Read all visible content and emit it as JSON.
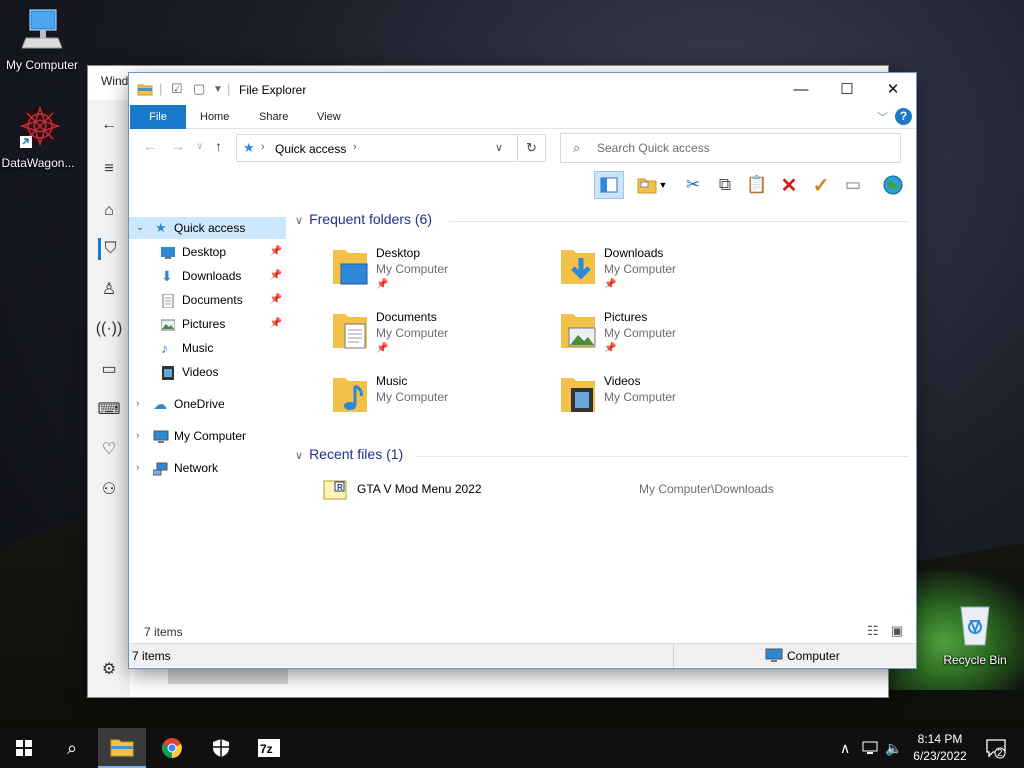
{
  "desktop": {
    "icons": [
      {
        "label": "My Computer"
      },
      {
        "label": "DataWagon..."
      },
      {
        "label": "Recycle Bin"
      }
    ]
  },
  "settings_window": {
    "title": "Wind"
  },
  "explorer": {
    "title": "File Explorer",
    "ribbon_tabs": [
      "File",
      "Home",
      "Share",
      "View"
    ],
    "address": "Quick access",
    "search_placeholder": "Search Quick access",
    "nav": [
      {
        "label": "Quick access",
        "icon": "star-icon",
        "selected": true
      },
      {
        "label": "Desktop",
        "icon": "desktop-icon",
        "pinned": true
      },
      {
        "label": "Downloads",
        "icon": "download-icon",
        "pinned": true
      },
      {
        "label": "Documents",
        "icon": "document-icon",
        "pinned": true
      },
      {
        "label": "Pictures",
        "icon": "picture-icon",
        "pinned": true
      },
      {
        "label": "Music",
        "icon": "music-icon"
      },
      {
        "label": "Videos",
        "icon": "video-icon"
      },
      {
        "label": "OneDrive",
        "icon": "cloud-icon"
      },
      {
        "label": "My Computer",
        "icon": "computer-icon"
      },
      {
        "label": "Network",
        "icon": "network-icon"
      }
    ],
    "frequent_header": "Frequent folders (6)",
    "folders": [
      {
        "name": "Desktop",
        "location": "My Computer",
        "pinned": true
      },
      {
        "name": "Downloads",
        "location": "My Computer",
        "pinned": true
      },
      {
        "name": "Documents",
        "location": "My Computer",
        "pinned": true
      },
      {
        "name": "Pictures",
        "location": "My Computer",
        "pinned": true
      },
      {
        "name": "Music",
        "location": "My Computer",
        "pinned": false
      },
      {
        "name": "Videos",
        "location": "My Computer",
        "pinned": false
      }
    ],
    "recent_header": "Recent files (1)",
    "recent_files": [
      {
        "name": "GTA V Mod Menu 2022",
        "path": "My Computer\\Downloads"
      }
    ],
    "status_items": "7 items",
    "status_items2": "7 items",
    "status_location": "Computer"
  },
  "taskbar": {
    "time": "8:14 PM",
    "date": "6/23/2022",
    "notification_count": "2",
    "pinned": [
      "start-icon",
      "search-icon",
      "file-explorer-icon",
      "chrome-icon",
      "security-icon",
      "7zip-icon"
    ]
  },
  "colors": {
    "accent": "#1979ca",
    "selection": "#cce8ff",
    "group_header": "#1e3287"
  }
}
